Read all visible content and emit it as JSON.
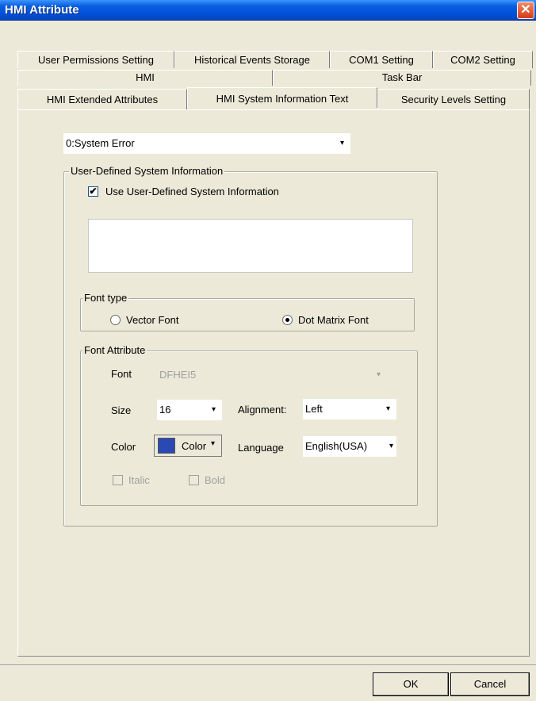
{
  "window": {
    "title": "HMI Attribute",
    "close_glyph": "✕"
  },
  "tabs_row1": [
    "User Permissions Setting",
    "Historical Events Storage",
    "COM1 Setting",
    "COM2 Setting"
  ],
  "tabs_row2": [
    "HMI",
    "Task Bar"
  ],
  "tabs_row3": [
    "HMI Extended Attributes",
    "HMI System Information Text",
    "Security Levels Setting"
  ],
  "message_select": {
    "value": "0:System Error"
  },
  "user_defined": {
    "legend": "User-Defined System Information",
    "checkbox_label": "Use User-Defined System Information",
    "checked": true,
    "text_value": ""
  },
  "font_type": {
    "legend": "Font type",
    "vector_label": "Vector Font",
    "dot_matrix_label": "Dot Matrix Font",
    "selected": "Dot Matrix Font"
  },
  "font_attribute": {
    "legend": "Font Attribute",
    "font_label": "Font",
    "font_value": "DFHEI5",
    "size_label": "Size",
    "size_value": "16",
    "alignment_label": "Alignment:",
    "alignment_value": "Left",
    "color_label": "Color",
    "color_button_label": "Color",
    "color_value": "#2a49b4",
    "language_label": "Language",
    "language_value": "English(USA)",
    "italic_label": "Italic",
    "bold_label": "Bold"
  },
  "buttons": {
    "ok": "OK",
    "cancel": "Cancel"
  },
  "icons": {
    "dropdown": "▾",
    "check": "✔"
  }
}
